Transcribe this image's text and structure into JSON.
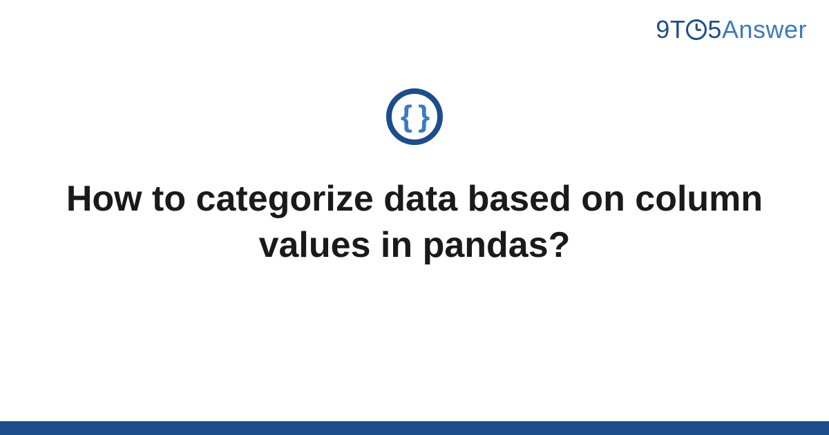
{
  "logo": {
    "part1": "9T",
    "part2": "5",
    "part3": "Answer"
  },
  "icon": {
    "symbol": "{ }",
    "name": "code-braces"
  },
  "title": "How to categorize data based on column values in pandas?",
  "colors": {
    "primary": "#1c4d8c",
    "accent": "#3a7ac4"
  }
}
